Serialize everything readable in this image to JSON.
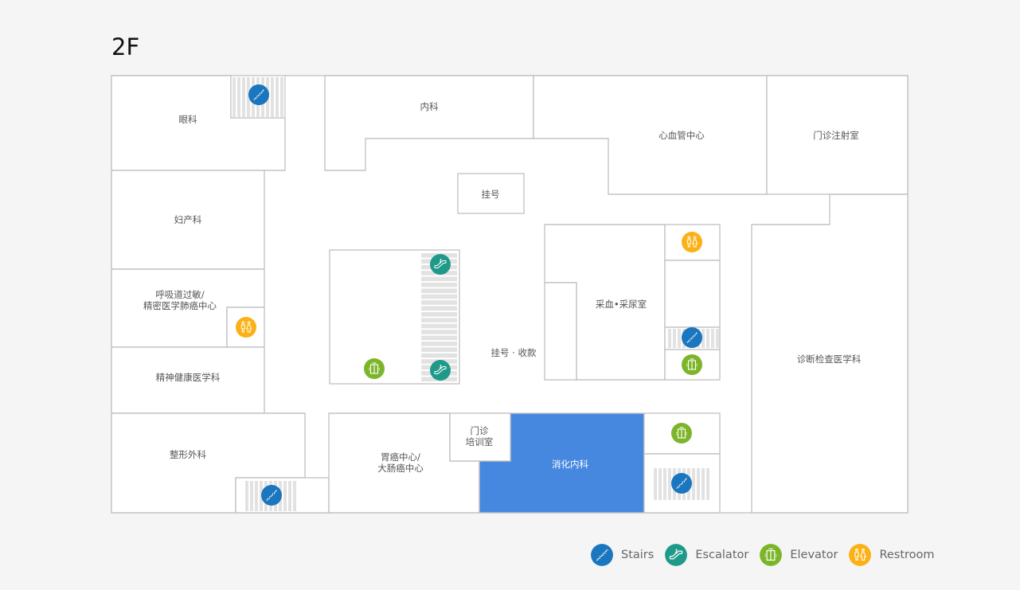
{
  "floor": {
    "title": "2F"
  },
  "colors": {
    "stairs": "#1a76be",
    "escalator": "#1f9a8a",
    "elevator": "#7db52a",
    "restroom": "#fbb116",
    "highlight": "#4688e0",
    "wall": "#c4c4c4"
  },
  "rooms": {
    "ophthalmology": "眼科",
    "internal_medicine": "内科",
    "cardiovascular": "心血管中心",
    "injection": "门诊注射室",
    "gynecology": "妇产科",
    "registration": "挂号",
    "respiratory_line1": "呼吸道过敏/",
    "respiratory_line2": "精密医学肺癌中心",
    "mental_health": "精神健康医学科",
    "registration_payment": "挂号 · 收款",
    "blood_urine": "采血•采尿室",
    "diagnostics": "诊断检查医学科",
    "plastic_surgery": "整形外科",
    "gastric_line1": "胃癌中心/",
    "gastric_line2": "大肠癌中心",
    "training_line1": "门诊",
    "training_line2": "培训室",
    "gastroenterology": "消化内科"
  },
  "legend": [
    {
      "icon": "stairs-icon",
      "label": "Stairs"
    },
    {
      "icon": "escalator-icon",
      "label": "Escalator"
    },
    {
      "icon": "elevator-icon",
      "label": "Elevator"
    },
    {
      "icon": "restroom-icon",
      "label": "Restroom"
    }
  ],
  "selected_room": "消化内科"
}
